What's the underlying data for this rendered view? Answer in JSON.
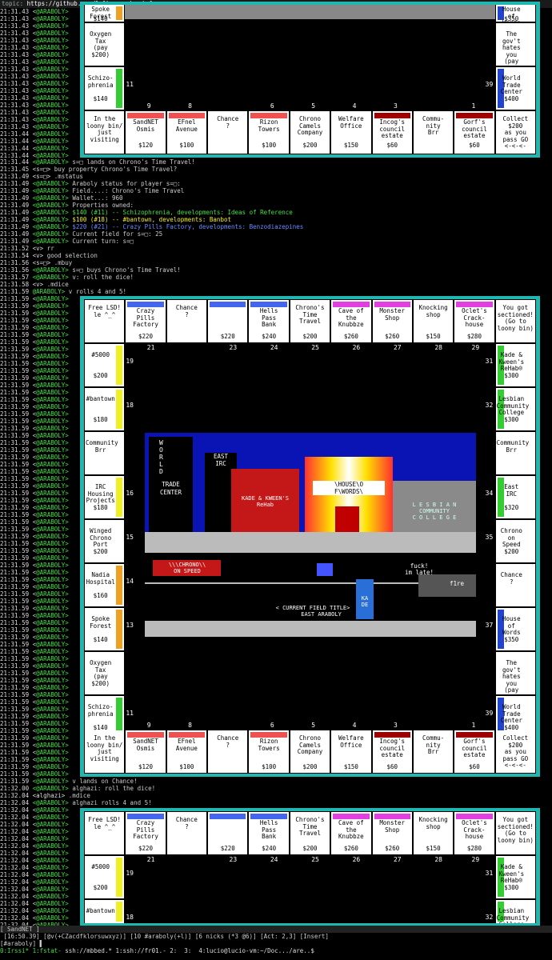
{
  "topic": {
    "label": "topic:",
    "url": "https://github.com/lalbornoz/araboly"
  },
  "nick_ar": "@ARABOLY>",
  "board1_log_times": [
    "21:31.43",
    "21:31.43",
    "21:31.43",
    "21:31.43",
    "21:31.43",
    "21:31.43",
    "21:31.43",
    "21:31.43",
    "21:31.43",
    "21:31.43",
    "21:31.43",
    "21:31.43",
    "21:31.43",
    "21:31.43",
    "21:31.43",
    "21:31.43",
    "21:31.43",
    "21:31.44",
    "21:31.44",
    "21:31.44",
    "21:31.44",
    "21:31.44"
  ],
  "chat1": [
    {
      "ts": "21:31.44",
      "nick": "<@ARABOLY>",
      "msg": "s=□ lands on Chrono's Time Travel!",
      "c": ""
    },
    {
      "ts": "21:31.45",
      "nick": "<s=□>",
      "msg": "buy property Chrono's Time Travel?",
      "c": ""
    },
    {
      "ts": "21:31.49",
      "nick": "<s=□>",
      "msg": ".mstatus",
      "c": ""
    },
    {
      "ts": "21:31.49",
      "nick": "<@ARABOLY>",
      "msg": "Araboly status for player s=□:",
      "c": ""
    },
    {
      "ts": "21:31.49",
      "nick": "<@ARABOLY>",
      "msg": "Field....: Chrono's Time Travel",
      "c": ""
    },
    {
      "ts": "21:31.49",
      "nick": "<@ARABOLY>",
      "msg": "Wallet...: 960",
      "c": ""
    },
    {
      "ts": "21:31.49",
      "nick": "<@ARABOLY>",
      "msg": "Properties owned:",
      "c": ""
    },
    {
      "ts": "21:31.49",
      "nick": "<@ARABOLY>",
      "msg": "$140 (#11) -- Schizophrenia, developments: Ideas of Reference",
      "c": "grn"
    },
    {
      "ts": "21:31.49",
      "nick": "<@ARABOLY>",
      "msg": "$100 (#18) -- #bantown, developments: Banbot",
      "c": "yel"
    },
    {
      "ts": "21:31.49",
      "nick": "<@ARABOLY>",
      "msg": "$220 (#21) -- Crazy Pills Factory, developments: Benzodiazepines",
      "c": "blu"
    },
    {
      "ts": "21:31.49",
      "nick": "<@ARABOLY>",
      "msg": "Current field for s=□: 25",
      "c": ""
    },
    {
      "ts": "21:31.49",
      "nick": "<@ARABOLY>",
      "msg": "Current turn: s=□",
      "c": ""
    },
    {
      "ts": "21:31.52",
      "nick": "<v>",
      "msg": "rr",
      "c": ""
    },
    {
      "ts": "21:31.54",
      "nick": "<v>",
      "msg": "good selection",
      "c": ""
    },
    {
      "ts": "21:31.56",
      "nick": "<s=□>",
      "msg": ".mbuy",
      "c": ""
    },
    {
      "ts": "21:31.56",
      "nick": "<@ARABOLY>",
      "msg": "s=□ buys Chrono's Time Travel!",
      "c": ""
    },
    {
      "ts": "21:31.57",
      "nick": "<@ARABOLY>",
      "msg": "v: roll the dice!",
      "c": ""
    },
    {
      "ts": "21:31.58",
      "nick": "<v>",
      "msg": ".mdice",
      "c": ""
    },
    {
      "ts": "21:31.59",
      "nick": "@ARABOLY>",
      "msg": "v rolls 4 and 5!",
      "c": ""
    }
  ],
  "board2_gutter_ts": "21:31.59",
  "chat2": [
    {
      "ts": "21:31.59",
      "nick": "<@ARABOLY>",
      "msg": "v lands on Chance!",
      "c": ""
    },
    {
      "ts": "21:32.00",
      "nick": "<@ARABOLY>",
      "msg": "alghazi: roll the dice!",
      "c": ""
    },
    {
      "ts": "21:32.04",
      "nick": "<alghazi>",
      "msg": ".mdice",
      "c": ""
    },
    {
      "ts": "21:32.04",
      "nick": "<@ARABOLY>",
      "msg": "alghazi rolls 4 and 5!",
      "c": ""
    }
  ],
  "board3_gutter_ts": "21:32.04",
  "top_row": [
    {
      "name": "Free LSD!\nle ^_^",
      "price": "",
      "color": ""
    },
    {
      "name": "Crazy\nPills\nFactory",
      "price": "$220",
      "color": "#4466ee"
    },
    {
      "name": "Chance\n?",
      "price": "",
      "color": ""
    },
    {
      "name": "",
      "price": "$220",
      "color": "#4466ee"
    },
    {
      "name": "Hells\nPass\nBank",
      "price": "$240",
      "color": "#4466ee"
    },
    {
      "name": "Chrono's\nTime\nTravel",
      "price": "$200",
      "color": ""
    },
    {
      "name": "Cave of\nthe\nKnubbze",
      "price": "$260",
      "color": "#e040e0"
    },
    {
      "name": "Monster\nShop",
      "price": "$260",
      "color": "#e040e0"
    },
    {
      "name": "Knocking\nshop",
      "price": "$150",
      "color": ""
    },
    {
      "name": "Oclet's\nCrack-\nhouse",
      "price": "$280",
      "color": "#e040e0"
    },
    {
      "name": "You got\nsectioned!\n(Go to\nloony bin)",
      "price": "",
      "color": ""
    }
  ],
  "top_nums": [
    "21",
    "23",
    "24",
    "25",
    "26",
    "27",
    "28",
    "29"
  ],
  "bottom_row": [
    {
      "name": "In the\nloony bin/\njust\nvisiting",
      "price": "",
      "color": ""
    },
    {
      "name": "SandNET\nOsmis",
      "price": "$120",
      "color": "#f05050"
    },
    {
      "name": "EFnel\nAvenue",
      "price": "$100",
      "color": "#f05050"
    },
    {
      "name": "Chance\n?",
      "price": "",
      "color": ""
    },
    {
      "name": "Rizon\nTowers",
      "price": "$100",
      "color": "#f05050"
    },
    {
      "name": "Chrono\nCamels\nCompany",
      "price": "$200",
      "color": ""
    },
    {
      "name": "Welfare\nOffice",
      "price": "$150",
      "color": ""
    },
    {
      "name": "Incog's\ncouncil\nestate",
      "price": "$60",
      "color": "#a00000"
    },
    {
      "name": "Commu-\nnity\nBrr",
      "price": "",
      "color": ""
    },
    {
      "name": "Gorf's\ncouncil\nestate",
      "price": "$60",
      "color": "#a00000"
    },
    {
      "name": "Collect\n$200\nas you\npass GO\n<-<-<-",
      "price": "",
      "color": ""
    }
  ],
  "bottom_nums": [
    "9",
    "8",
    "6",
    "5",
    "4",
    "3",
    "1"
  ],
  "left_col": [
    {
      "name": "#5000",
      "price": "$200",
      "color": "#f0f020",
      "num": "19"
    },
    {
      "name": "#bantown",
      "price": "$180",
      "color": "#f0f020",
      "num": "18"
    },
    {
      "name": "Community\nBrr",
      "price": "",
      "color": "",
      "num": ""
    },
    {
      "name": "IRC\nHousing\nProjects",
      "price": "$180",
      "color": "#f0f020",
      "num": "16"
    },
    {
      "name": "Winged\nChrono\nPort",
      "price": "$200",
      "color": "",
      "num": "15"
    },
    {
      "name": "Nadia\nHospital",
      "price": "$160",
      "color": "#f0a020",
      "num": "14"
    },
    {
      "name": "Spoke\nForest",
      "price": "$140",
      "color": "#f0a020",
      "num": "13"
    },
    {
      "name": "Oxygen\nTax\n(pay\n$200)",
      "price": "",
      "color": "",
      "num": ""
    },
    {
      "name": "Schizo-\nphrenia",
      "price": "$140",
      "color": "#33cc33",
      "num": "11"
    }
  ],
  "right_col": [
    {
      "name": "Kade &\nKween's\nReHab®",
      "price": "$300",
      "color": "#33cc33",
      "num": "31"
    },
    {
      "name": "Lesbian\nCommunity\nCollege",
      "price": "$300",
      "color": "#33cc33",
      "num": "32"
    },
    {
      "name": "Community\nBrr",
      "price": "",
      "color": "",
      "num": ""
    },
    {
      "name": "East\nIRC",
      "price": "$320",
      "color": "#33cc33",
      "num": "34"
    },
    {
      "name": "Chrono on\nSpeed",
      "price": "$200",
      "color": "",
      "num": "35"
    },
    {
      "name": "Chance\n?",
      "price": "",
      "color": "",
      "num": ""
    },
    {
      "name": "House\nof\nWords",
      "price": "$350",
      "color": "#2244cc",
      "num": "37"
    },
    {
      "name": "The gov't\nhates\nyou\n(pay $100)",
      "price": "",
      "color": "",
      "num": ""
    },
    {
      "name": "World\nTrade\nCenter",
      "price": "$400",
      "color": "#2244cc",
      "num": "39"
    }
  ],
  "scene": {
    "wordart": "W\nO\nR\nL\nD",
    "trade": "TRADE\nCENTER",
    "east": "EAST\nIRC",
    "rehab": "KADE & KWEEN'S\nReHab",
    "house": "\\HOUSE\\O\nF\\WORDS\\",
    "lesbian": "L E S B I A N\nCOMMUNITY\nC O L L E G E",
    "chrono": "\\\\\\CHRONO\\\\\nON SPEED",
    "fuck": "fuck!\nim late!",
    "fire": "f1re",
    "title": "< CURRENT FIELD TITLE>\n     EAST ARABOLY",
    "ka": "KA\nDE"
  },
  "status": {
    "win": "[ SandNET ]",
    "line1": " [16:50.39] [@v(+CZacdfklorsuwxyz)] [10 #araboly(+l)] [6 nicks (*3 @6)] [Act: 2,3] [Insert]",
    "line2": "[#araboly] ▌",
    "tmux": "0:Irssi* 1:fstat- ",
    "tmux2": "ssh://mbbed.* 1:ssh://fr01.- 2:  3:  4:lucio@lucio-vm:~/Doc.../are..$"
  }
}
